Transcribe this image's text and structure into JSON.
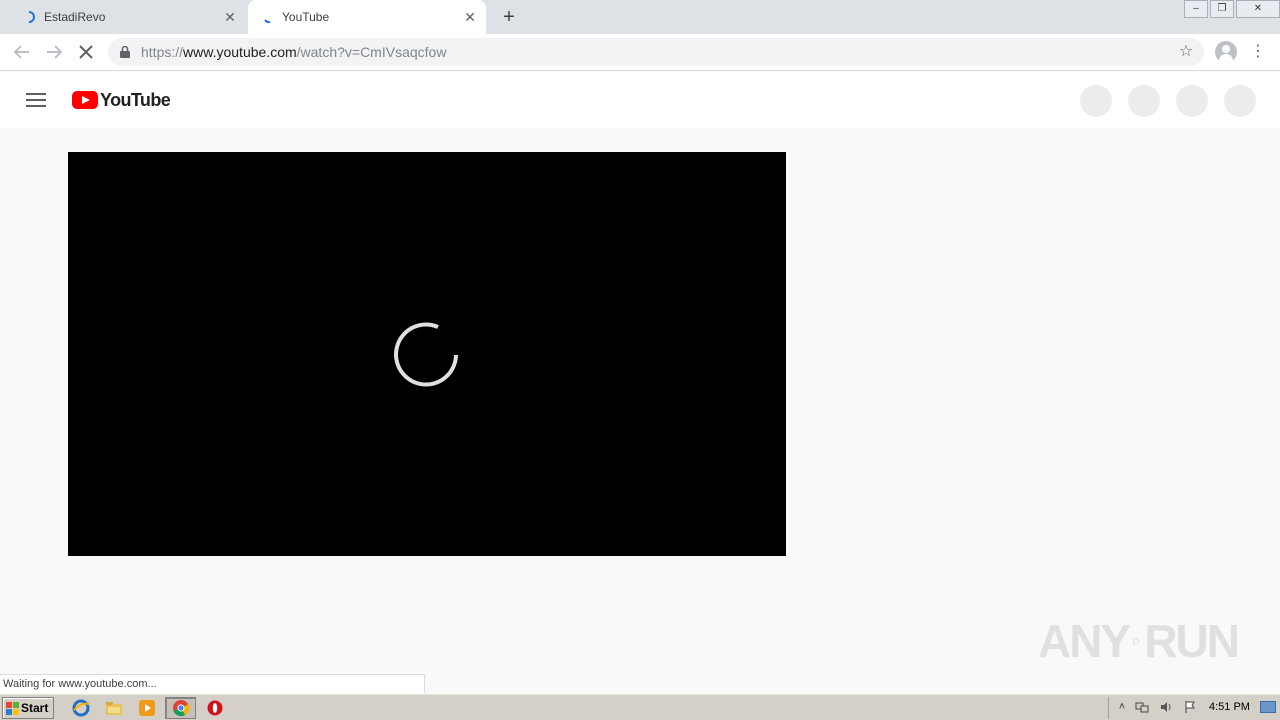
{
  "browser": {
    "tabs": [
      {
        "title": "EstadiRevo",
        "active": false
      },
      {
        "title": "YouTube",
        "active": true
      }
    ],
    "new_tab_label": "+",
    "window_controls": {
      "minimize": "–",
      "restore": "❐",
      "close": "✕"
    },
    "url": {
      "scheme": "https://",
      "host": "www.youtube.com",
      "path": "/watch?v=CmIVsaqcfow"
    },
    "status_text": "Waiting for www.youtube.com..."
  },
  "youtube": {
    "logo_text": "YouTube",
    "colors": {
      "brand_red": "#ff0000",
      "video_bg": "#000000",
      "page_bg": "#f9f9f9"
    }
  },
  "watermark": {
    "left": "ANY",
    "right": "RUN"
  },
  "taskbar": {
    "start_label": "Start",
    "clock": "4:51 PM"
  }
}
